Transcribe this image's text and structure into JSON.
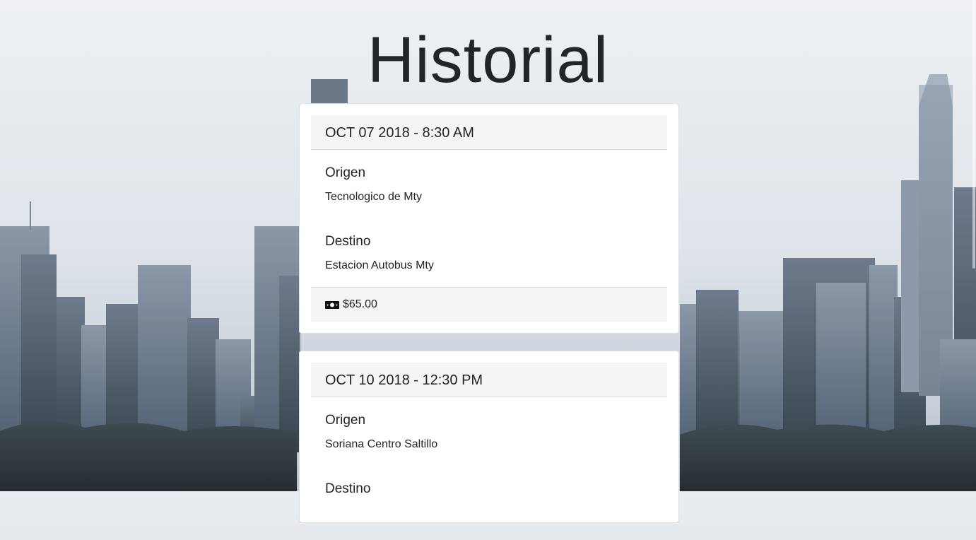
{
  "page": {
    "title": "Historial"
  },
  "trips": [
    {
      "datetime": "OCT 07 2018 - 8:30 AM",
      "origin_label": "Origen",
      "origin_value": "Tecnologico de Mty",
      "destination_label": "Destino",
      "destination_value": "Estacion Autobus Mty",
      "price": "$65.00",
      "price_icon": "money-bill-icon"
    },
    {
      "datetime": "OCT 10 2018 - 12:30 PM",
      "origin_label": "Origen",
      "origin_value": "Soriana Centro Saltillo",
      "destination_label": "Destino",
      "destination_value": ""
    }
  ],
  "colors": {
    "text": "#212529",
    "card_background": "#ffffff",
    "card_header_background": "#f5f5f5"
  }
}
